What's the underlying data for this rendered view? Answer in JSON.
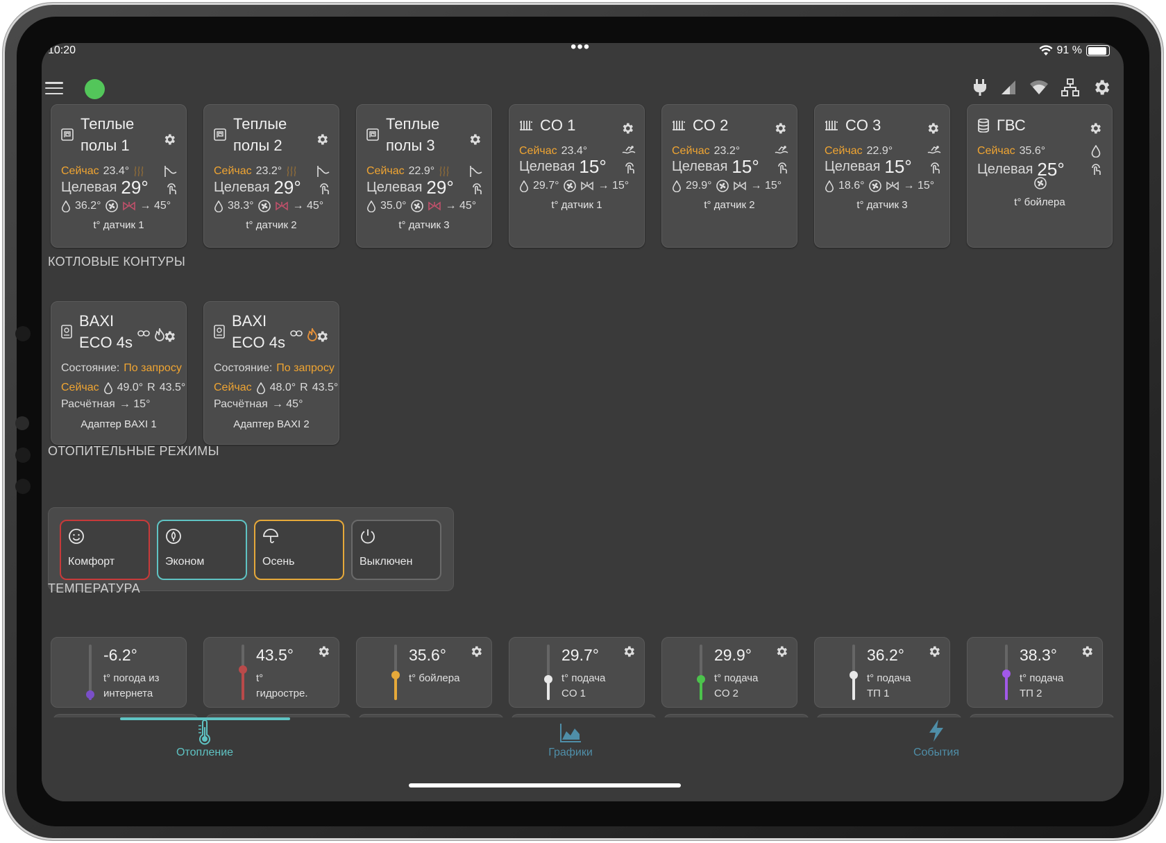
{
  "status_bar": {
    "time": "10:20",
    "dots": "•••",
    "battery": "91 %",
    "battery_level": 0.91
  },
  "floor_cards": [
    {
      "title1": "Теплые",
      "title2": "полы 1",
      "now_label": "Сейчас",
      "now": "23.4°",
      "target_label": "Целевая",
      "target": "29°",
      "humidity": "36.2°",
      "flow": "→ 45°",
      "sensor": "t° датчик 1"
    },
    {
      "title1": "Теплые",
      "title2": "полы 2",
      "now_label": "Сейчас",
      "now": "23.2°",
      "target_label": "Целевая",
      "target": "29°",
      "humidity": "38.3°",
      "flow": "→ 45°",
      "sensor": "t° датчик 2"
    },
    {
      "title1": "Теплые",
      "title2": "полы 3",
      "now_label": "Сейчас",
      "now": "22.9°",
      "target_label": "Целевая",
      "target": "29°",
      "humidity": "35.0°",
      "flow": "→ 45°",
      "sensor": "t° датчик 3"
    }
  ],
  "co_cards": [
    {
      "title": "CO 1",
      "now_label": "Сейчас",
      "now": "23.4°",
      "target_label": "Целевая",
      "target": "15°",
      "humidity": "29.7°",
      "flow": "→ 15°",
      "sensor": "t° датчик 1"
    },
    {
      "title": "CO 2",
      "now_label": "Сейчас",
      "now": "23.2°",
      "target_label": "Целевая",
      "target": "15°",
      "humidity": "29.9°",
      "flow": "→ 15°",
      "sensor": "t° датчик 2"
    },
    {
      "title": "CO 3",
      "now_label": "Сейчас",
      "now": "22.9°",
      "target_label": "Целевая",
      "target": "15°",
      "humidity": "18.6°",
      "flow": "→ 15°",
      "sensor": "t° датчик 3"
    }
  ],
  "gvs_card": {
    "title": "ГВС",
    "now_label": "Сейчас",
    "now": "35.6°",
    "target_label": "Целевая",
    "target": "25°",
    "sensor": "t° бойлера"
  },
  "boiler_section": {
    "title": "КОТЛОВЫЕ КОНТУРЫ"
  },
  "boilers": [
    {
      "title1": "BAXI",
      "title2": "ECO 4s",
      "state_label": "Состояние:",
      "state": "По запросу",
      "now_label": "Сейчас",
      "now": "49.0°",
      "r": "R",
      "r_val": "43.5°",
      "calc_label": "Расчётная",
      "calc": "→ 15°",
      "adapter": "Адаптер BAXI 1",
      "flame_color": "#d9d9d9"
    },
    {
      "title1": "BAXI",
      "title2": "ECO 4s",
      "state_label": "Состояние:",
      "state": "По запросу",
      "now_label": "Сейчас",
      "now": "48.0°",
      "r": "R",
      "r_val": "43.5°",
      "calc_label": "Расчётная",
      "calc": "→ 45°",
      "adapter": "Адаптер BAXI 2",
      "flame_color": "#e8923a"
    }
  ],
  "modes_section": {
    "title": "ОТОПИТЕЛЬНЫЕ РЕЖИМЫ"
  },
  "modes": [
    {
      "label": "Комфорт",
      "icon": "smile-icon",
      "border": "#c83a3a"
    },
    {
      "label": "Эконом",
      "icon": "eco-icon",
      "border": "#5fc3c3"
    },
    {
      "label": "Осень",
      "icon": "umbrella-icon",
      "border": "#e6a93a"
    },
    {
      "label": "Выключен",
      "icon": "power-icon",
      "border": "#6a6a6a"
    }
  ],
  "temp_section": {
    "title": "ТЕМПЕРАТУРА"
  },
  "temps": [
    {
      "value": "-6.2°",
      "line1": "t° погода из",
      "line2": "интернета",
      "color": "#7a4fc9",
      "level": 0.1,
      "gear": false
    },
    {
      "value": "43.5°",
      "line1": "t°",
      "line2": "гидростре.",
      "color": "#b94a4a",
      "level": 0.55,
      "gear": true
    },
    {
      "value": "35.6°",
      "line1": "t° бойлера",
      "line2": "",
      "color": "#e6a93a",
      "level": 0.45,
      "gear": true
    },
    {
      "value": "29.7°",
      "line1": "t° подача",
      "line2": "CO 1",
      "color": "#e8e8e8",
      "level": 0.38,
      "gear": true
    },
    {
      "value": "29.9°",
      "line1": "t° подача",
      "line2": "CO 2",
      "color": "#4cc24c",
      "level": 0.38,
      "gear": true
    },
    {
      "value": "36.2°",
      "line1": "t° подача",
      "line2": "ТП 1",
      "color": "#e8e8e8",
      "level": 0.45,
      "gear": true
    },
    {
      "value": "38.3°",
      "line1": "t° подача",
      "line2": "ТП 2",
      "color": "#a259e8",
      "level": 0.48,
      "gear": true
    }
  ],
  "tabs": [
    {
      "label": "Отопление",
      "icon": "thermometer-icon",
      "color": "#5fc3c3"
    },
    {
      "label": "Графики",
      "icon": "chart-icon",
      "color": "#4f8ea8"
    },
    {
      "label": "События",
      "icon": "lightning-icon",
      "color": "#4f8ea8"
    }
  ],
  "colors": {
    "accent": "#5fc3c3",
    "orange": "#f0a532",
    "online": "#53c65a"
  }
}
